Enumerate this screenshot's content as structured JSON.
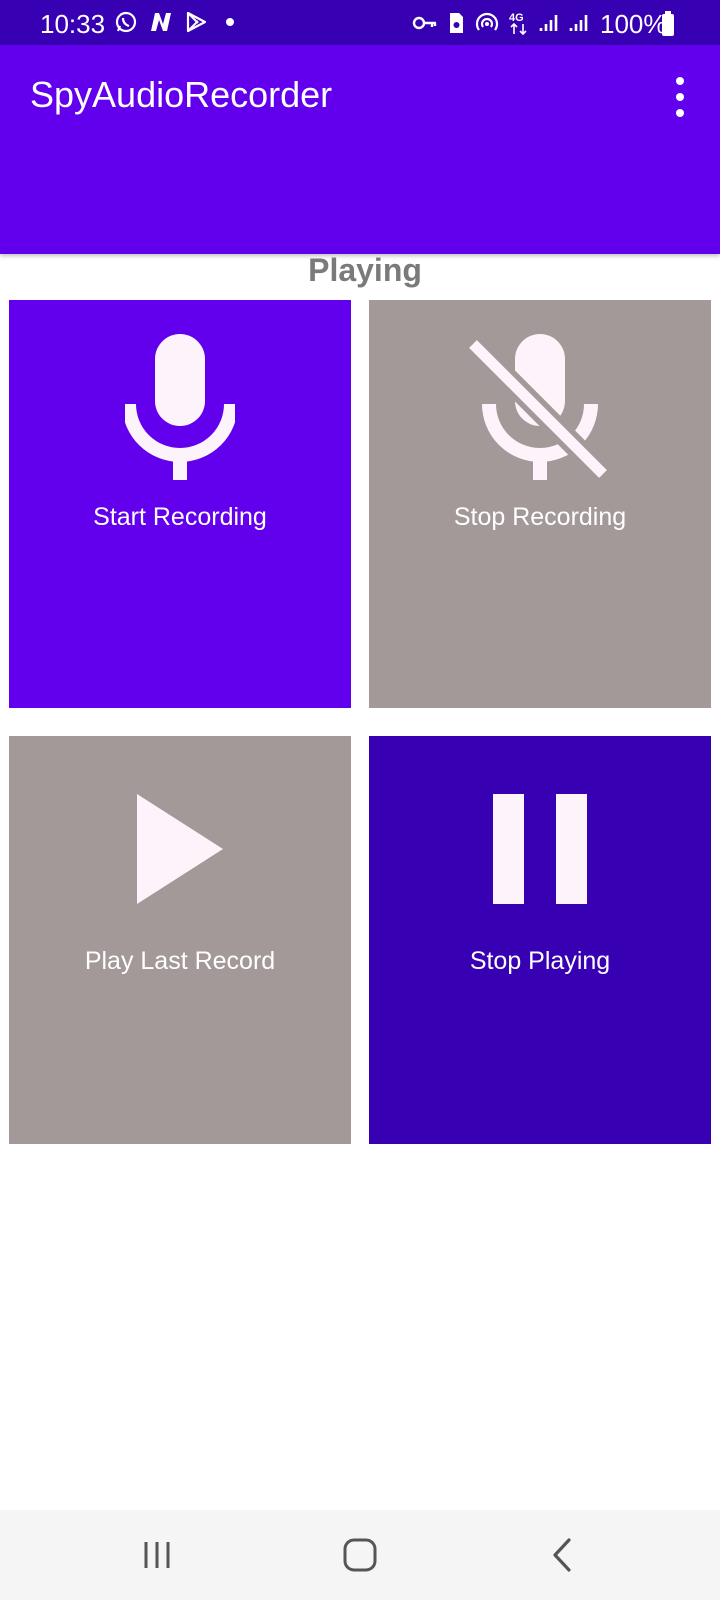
{
  "status_bar": {
    "time": "10:33",
    "battery": "100%",
    "left_icons": [
      "whatsapp-icon",
      "n-app-icon",
      "play-store-icon",
      "dot-icon"
    ],
    "right_icons": [
      "vpn-key-icon",
      "sim-icon",
      "hotspot-icon",
      "4g-icon",
      "signal-icon",
      "signal-icon",
      "battery-icon"
    ]
  },
  "app_bar": {
    "title": "SpyAudioRecorder",
    "menu_icon": "more-vert-icon",
    "color": "#6200ee"
  },
  "status_label": "Playing",
  "tiles": {
    "start_recording": {
      "label": "Start Recording",
      "icon": "microphone-icon",
      "color": "#6200ee"
    },
    "stop_recording": {
      "label": "Stop Recording",
      "icon": "microphone-off-icon",
      "color": "#a39998"
    },
    "play_last_record": {
      "label": "Play Last Record",
      "icon": "play-icon",
      "color": "#a39998"
    },
    "stop_playing": {
      "label": "Stop Playing",
      "icon": "pause-icon",
      "color": "#3700b3"
    }
  },
  "nav_bar": {
    "buttons": [
      "recents-icon",
      "home-icon",
      "back-icon"
    ]
  },
  "colors": {
    "primary": "#6200ee",
    "primary_dark": "#3700b3",
    "disabled": "#a39998",
    "icon_tint": "#fdf3fb"
  }
}
